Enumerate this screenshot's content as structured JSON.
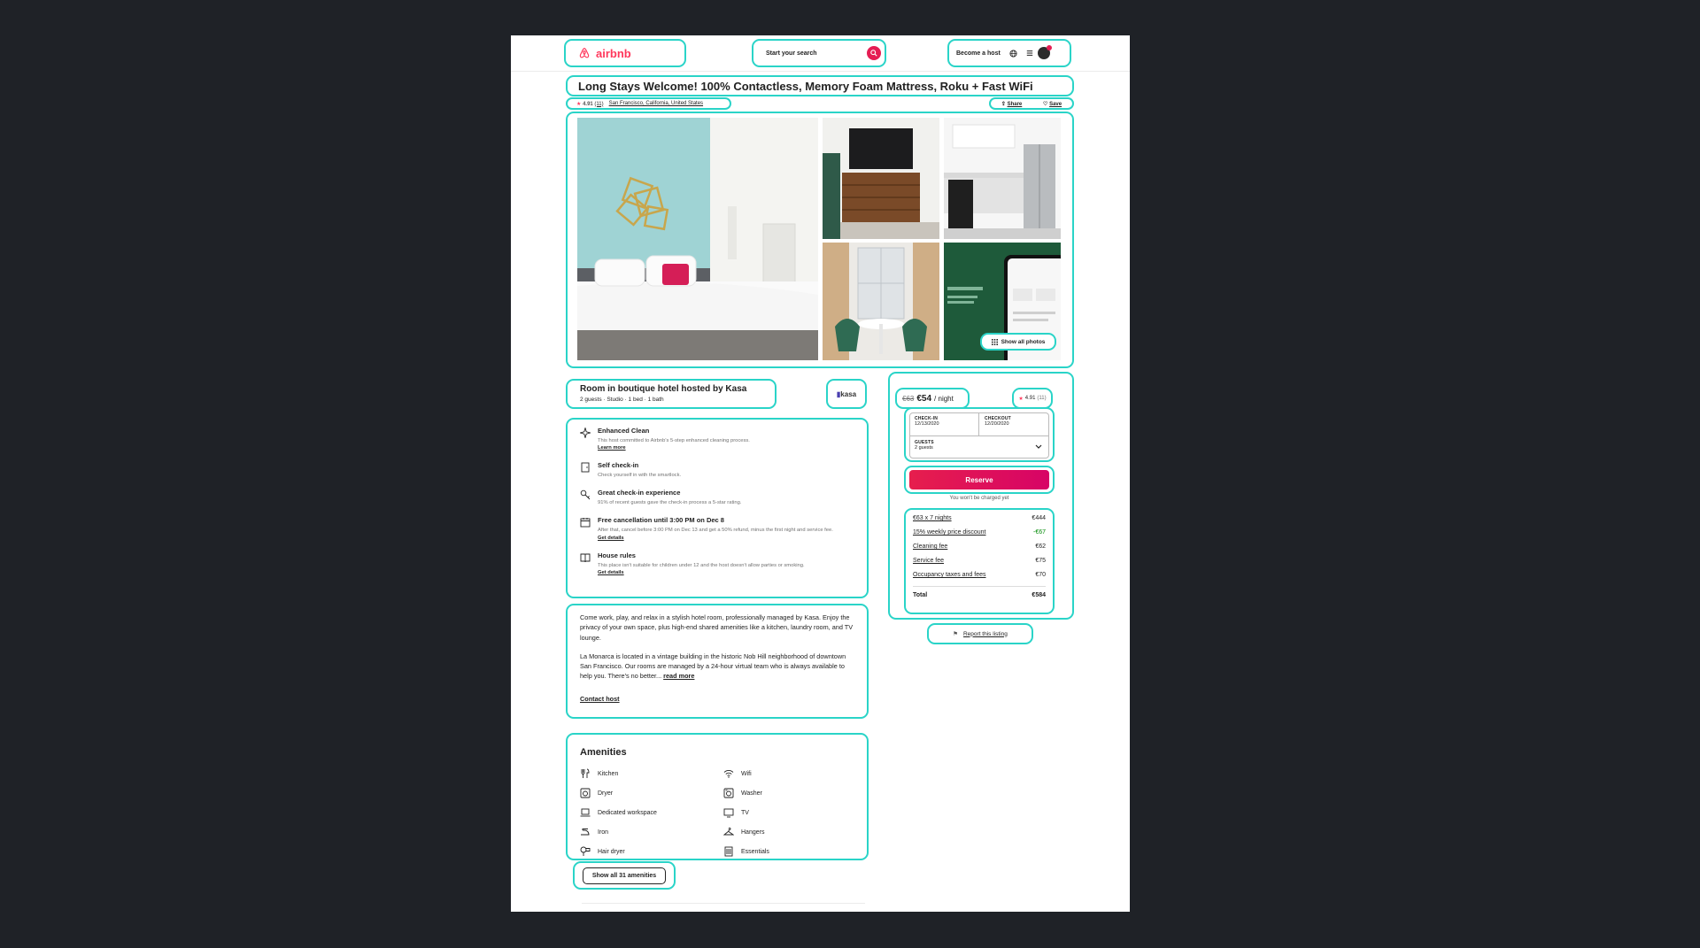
{
  "header": {
    "brand": "airbnb",
    "search_label": "Start your search",
    "become_host": "Become a host"
  },
  "listing": {
    "title": "Long Stays Welcome! 100% Contactless, Memory Foam Mattress, Roku + Fast WiFi",
    "rating": "4.91",
    "reviews": "(11)",
    "location": "San Francisco, California, United States",
    "share": "Share",
    "save": "Save",
    "show_all_photos": "Show all photos"
  },
  "host": {
    "heading": "Room in boutique hotel hosted by Kasa",
    "details": "2 guests · Studio · 1 bed · 1 bath",
    "logo_text": "kasa"
  },
  "features": [
    {
      "title": "Enhanced Clean",
      "text": "This host committed to Airbnb's 5-step enhanced cleaning process.",
      "link": "Learn more"
    },
    {
      "title": "Self check-in",
      "text": "Check yourself in with the smartlock.",
      "link": ""
    },
    {
      "title": "Great check-in experience",
      "text": "91% of recent guests gave the check-in process a 5-star rating.",
      "link": ""
    },
    {
      "title": "Free cancellation until 3:00 PM on Dec 8",
      "text": "After that, cancel before 3:00 PM on Dec 13 and get a 50% refund, minus the first night and service fee.",
      "link": "Get details"
    },
    {
      "title": "House rules",
      "text": "This place isn't suitable for children under 12 and the host doesn't allow parties or smoking.",
      "link": "Get details"
    }
  ],
  "description": {
    "p1": "Come work, play, and relax in a stylish hotel room, professionally managed by Kasa. Enjoy the privacy of your own space, plus high-end shared amenities like a kitchen, laundry room, and TV lounge.",
    "p2": "La Monarca is located in a vintage building in the historic Nob Hill neighborhood of downtown San Francisco. Our rooms are managed by a 24-hour virtual team who is always available to help you. There's no better...",
    "read_more": "read more",
    "contact": "Contact host"
  },
  "amenities": {
    "heading": "Amenities",
    "items": [
      "Kitchen",
      "Wifi",
      "Dryer",
      "Washer",
      "Dedicated workspace",
      "TV",
      "Iron",
      "Hangers",
      "Hair dryer",
      "Essentials"
    ],
    "show_all": "Show all 31 amenities"
  },
  "booking": {
    "old_price": "€63",
    "price": "€54",
    "per": "/ night",
    "rating": "4.91",
    "reviews": "(11)",
    "checkin_label": "CHECK-IN",
    "checkin_value": "12/13/2020",
    "checkout_label": "CHECKOUT",
    "checkout_value": "12/20/2020",
    "guests_label": "GUESTS",
    "guests_value": "2 guests",
    "reserve": "Reserve",
    "no_charge": "You won't be charged yet",
    "fees": [
      {
        "label": "€63 x 7 nights",
        "value": "€444"
      },
      {
        "label": "15% weekly price discount",
        "value": "-€67"
      },
      {
        "label": "Cleaning fee",
        "value": "€62"
      },
      {
        "label": "Service fee",
        "value": "€75"
      },
      {
        "label": "Occupancy taxes and fees",
        "value": "€70"
      }
    ],
    "total_label": "Total",
    "total_value": "€584",
    "report": "Report this listing"
  },
  "colors": {
    "accent": "#ff385c",
    "highlight": "#2ad4c8",
    "discount": "#008a05"
  }
}
